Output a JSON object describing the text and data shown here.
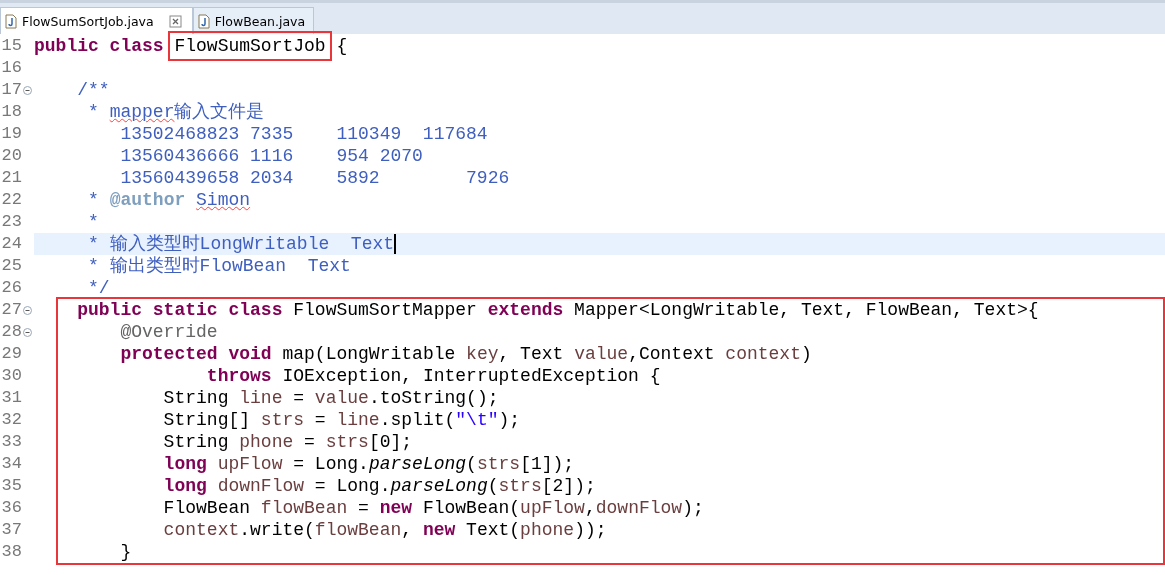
{
  "tabs": [
    {
      "label": "FlowSumSortJob.java",
      "selected": true
    },
    {
      "label": "FlowBean.java",
      "selected": false
    }
  ],
  "lines": [
    {
      "number": "15",
      "fold": false,
      "current": false,
      "in_box": false,
      "segments": [
        {
          "kind": "kw",
          "text": "public class "
        },
        {
          "kind": "boxed",
          "text": "FlowSumSortJob"
        },
        {
          "kind": "plain",
          "text": " {"
        }
      ]
    },
    {
      "number": "16",
      "fold": false,
      "current": false,
      "in_box": false
    },
    {
      "number": "17",
      "fold": true,
      "current": false,
      "in_box": false,
      "segments": [
        {
          "kind": "comment",
          "text": "    /**"
        }
      ]
    },
    {
      "number": "18",
      "fold": false,
      "current": false,
      "in_box": false,
      "segments": [
        {
          "kind": "comment",
          "text": "     * "
        },
        {
          "kind": "typo",
          "text": "mapper"
        },
        {
          "kind": "comment",
          "text": "输入文件是"
        }
      ]
    },
    {
      "number": "19",
      "fold": false,
      "current": false,
      "in_box": false,
      "segments": [
        {
          "kind": "comment",
          "text": "        13502468823 7335    110349  117684"
        }
      ]
    },
    {
      "number": "20",
      "fold": false,
      "current": false,
      "in_box": false,
      "segments": [
        {
          "kind": "comment",
          "text": "        13560436666 1116    954 2070"
        }
      ]
    },
    {
      "number": "21",
      "fold": false,
      "current": false,
      "in_box": false,
      "segments": [
        {
          "kind": "comment",
          "text": "        13560439658 2034    5892        7926"
        }
      ]
    },
    {
      "number": "22",
      "fold": false,
      "current": false,
      "in_box": false,
      "segments": [
        {
          "kind": "comment",
          "text": "     * "
        },
        {
          "kind": "doctag",
          "text": "@author "
        },
        {
          "kind": "typo",
          "text": "Simon"
        }
      ]
    },
    {
      "number": "23",
      "fold": false,
      "current": false,
      "in_box": false,
      "segments": [
        {
          "kind": "comment",
          "text": "     *"
        }
      ]
    },
    {
      "number": "24",
      "fold": false,
      "current": true,
      "in_box": false,
      "segments": [
        {
          "kind": "comment",
          "text": "     * 输入类型时LongWritable  Text"
        }
      ]
    },
    {
      "number": "25",
      "fold": false,
      "current": false,
      "in_box": false,
      "segments": [
        {
          "kind": "comment",
          "text": "     * 输出类型时FlowBean  Text"
        }
      ]
    },
    {
      "number": "26",
      "fold": false,
      "current": false,
      "in_box": false,
      "segments": [
        {
          "kind": "comment",
          "text": "     */"
        }
      ]
    },
    {
      "number": "27",
      "fold": true,
      "current": false,
      "in_box": true,
      "segments": [
        {
          "kind": "kw",
          "text": "    public static class "
        },
        {
          "kind": "plain",
          "text": "FlowSumSortMapper "
        },
        {
          "kind": "kw",
          "text": "extends "
        },
        {
          "kind": "plain",
          "text": "Mapper<LongWritable, Text, FlowBean, Text>{"
        }
      ]
    },
    {
      "number": "28",
      "fold": true,
      "current": false,
      "in_box": true,
      "segments": [
        {
          "kind": "ann",
          "text": "        @Override"
        }
      ]
    },
    {
      "number": "29",
      "fold": false,
      "current": false,
      "in_box": true,
      "segments": [
        {
          "kind": "kw",
          "text": "        protected void "
        },
        {
          "kind": "plain",
          "text": "map(LongWritable "
        },
        {
          "kind": "var",
          "text": "key"
        },
        {
          "kind": "plain",
          "text": ", Text "
        },
        {
          "kind": "var",
          "text": "value"
        },
        {
          "kind": "plain",
          "text": ",Context "
        },
        {
          "kind": "var",
          "text": "context"
        },
        {
          "kind": "plain",
          "text": ")"
        }
      ]
    },
    {
      "number": "30",
      "fold": false,
      "current": false,
      "in_box": true,
      "segments": [
        {
          "kind": "kw",
          "text": "                throws "
        },
        {
          "kind": "plain",
          "text": "IOException, InterruptedException {"
        }
      ]
    },
    {
      "number": "31",
      "fold": false,
      "current": false,
      "in_box": true,
      "segments": [
        {
          "kind": "plain",
          "text": "            String "
        },
        {
          "kind": "var",
          "text": "line"
        },
        {
          "kind": "plain",
          "text": " = "
        },
        {
          "kind": "var",
          "text": "value"
        },
        {
          "kind": "plain",
          "text": ".toString();"
        }
      ]
    },
    {
      "number": "32",
      "fold": false,
      "current": false,
      "in_box": true,
      "segments": [
        {
          "kind": "plain",
          "text": "            String[] "
        },
        {
          "kind": "var",
          "text": "strs"
        },
        {
          "kind": "plain",
          "text": " = "
        },
        {
          "kind": "var",
          "text": "line"
        },
        {
          "kind": "plain",
          "text": ".split("
        },
        {
          "kind": "str",
          "text": "\"\\t\""
        },
        {
          "kind": "plain",
          "text": ");"
        }
      ]
    },
    {
      "number": "33",
      "fold": false,
      "current": false,
      "in_box": true,
      "segments": [
        {
          "kind": "plain",
          "text": "            String "
        },
        {
          "kind": "var",
          "text": "phone"
        },
        {
          "kind": "plain",
          "text": " = "
        },
        {
          "kind": "var",
          "text": "strs"
        },
        {
          "kind": "plain",
          "text": "[0];"
        }
      ]
    },
    {
      "number": "34",
      "fold": false,
      "current": false,
      "in_box": true,
      "segments": [
        {
          "kind": "kw",
          "text": "            long "
        },
        {
          "kind": "var",
          "text": "upFlow"
        },
        {
          "kind": "plain",
          "text": " = Long."
        },
        {
          "kind": "static",
          "text": "parseLong"
        },
        {
          "kind": "plain",
          "text": "("
        },
        {
          "kind": "var",
          "text": "strs"
        },
        {
          "kind": "plain",
          "text": "[1]);"
        }
      ]
    },
    {
      "number": "35",
      "fold": false,
      "current": false,
      "in_box": true,
      "segments": [
        {
          "kind": "kw",
          "text": "            long "
        },
        {
          "kind": "var",
          "text": "downFlow"
        },
        {
          "kind": "plain",
          "text": " = Long."
        },
        {
          "kind": "static",
          "text": "parseLong"
        },
        {
          "kind": "plain",
          "text": "("
        },
        {
          "kind": "var",
          "text": "strs"
        },
        {
          "kind": "plain",
          "text": "[2]);"
        }
      ]
    },
    {
      "number": "36",
      "fold": false,
      "current": false,
      "in_box": true,
      "segments": [
        {
          "kind": "plain",
          "text": "            FlowBean "
        },
        {
          "kind": "var",
          "text": "flowBean"
        },
        {
          "kind": "plain",
          "text": " = "
        },
        {
          "kind": "kw",
          "text": "new"
        },
        {
          "kind": "plain",
          "text": " FlowBean("
        },
        {
          "kind": "var",
          "text": "upFlow"
        },
        {
          "kind": "plain",
          "text": ","
        },
        {
          "kind": "var",
          "text": "downFlow"
        },
        {
          "kind": "plain",
          "text": ");"
        }
      ]
    },
    {
      "number": "37",
      "fold": false,
      "current": false,
      "in_box": true,
      "segments": [
        {
          "kind": "var",
          "text": "            context"
        },
        {
          "kind": "plain",
          "text": ".write("
        },
        {
          "kind": "var",
          "text": "flowBean"
        },
        {
          "kind": "plain",
          "text": ", "
        },
        {
          "kind": "kw",
          "text": "new"
        },
        {
          "kind": "plain",
          "text": " Text("
        },
        {
          "kind": "var",
          "text": "phone"
        },
        {
          "kind": "plain",
          "text": "));"
        }
      ]
    },
    {
      "number": "38",
      "fold": false,
      "current": false,
      "in_box": true,
      "segments": [
        {
          "kind": "plain",
          "text": "        }"
        }
      ]
    }
  ]
}
